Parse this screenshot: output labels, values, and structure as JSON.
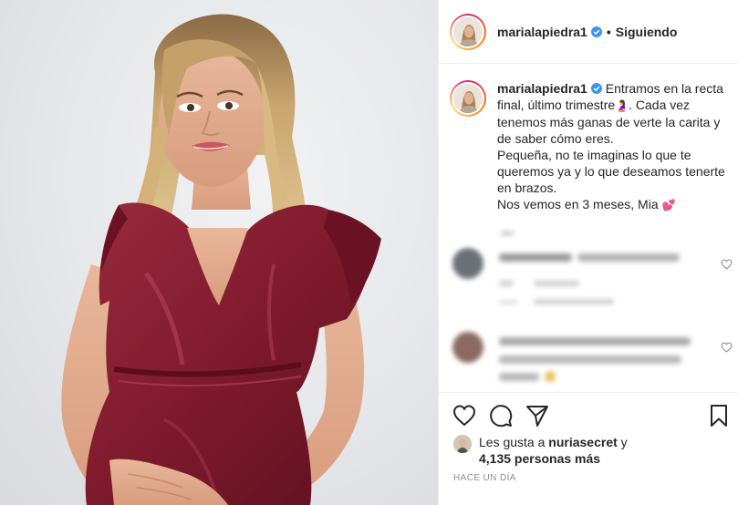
{
  "post": {
    "username": "marialapiedra1",
    "follow_status": "Siguiendo",
    "separator": "•",
    "caption": {
      "line1": "Entramos en la recta final, último trimestre",
      "emoji_pregnant": "🤰",
      "line1_end": ". Cada vez tenemos más ganas de verte la carita y de saber cómo eres.",
      "line2": "Pequeña, no te imaginas lo que te queremos ya y lo que deseamos tenerte en brazos.",
      "line3": "Nos vemos en 3 meses, Mia",
      "emoji_hearts": "💕"
    },
    "likes": {
      "prefix": "Les gusta a",
      "user": "nuriasecret",
      "conj": "y",
      "count": "4,135 personas más"
    },
    "timestamp": "HACE UN DÍA"
  },
  "colors": {
    "verified": "#3897f0",
    "border": "#efefef",
    "muted": "#8e8e8e",
    "dress": "#7e1a2c"
  },
  "icons": [
    "verified-icon",
    "heart-icon",
    "comment-icon",
    "share-icon",
    "bookmark-icon"
  ]
}
